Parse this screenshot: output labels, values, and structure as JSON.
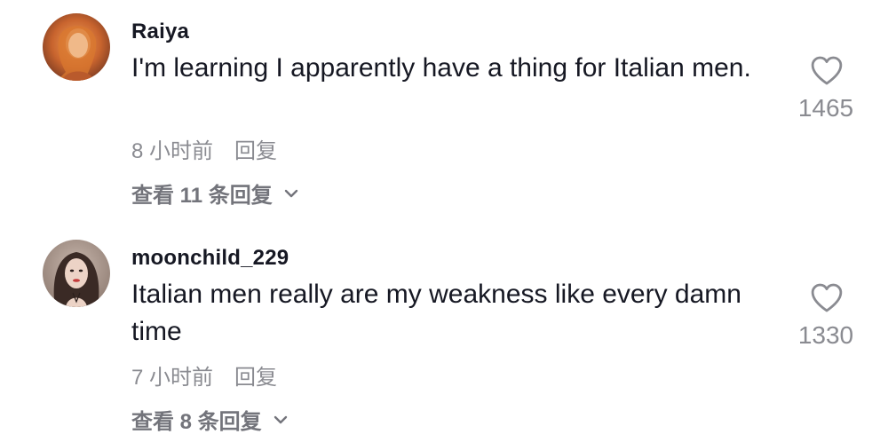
{
  "comments": [
    {
      "username": "Raiya",
      "avatar_icon": "user-avatar",
      "text": "I'm learning I apparently have a thing for Italian men.",
      "time": "8 小时前",
      "reply_label": "回复",
      "view_replies": "查看 11 条回复",
      "like_icon": "heart-outline-icon",
      "like_count": "1465"
    },
    {
      "username": "moonchild_229",
      "avatar_icon": "user-avatar",
      "text": "Italian men really are my weakness like every damn time",
      "time": "7 小时前",
      "reply_label": "回复",
      "view_replies": "查看 8 条回复",
      "like_icon": "heart-outline-icon",
      "like_count": "1330"
    }
  ],
  "colors": {
    "primary_text": "#161823",
    "secondary_text": "#8a8b91",
    "view_replies_text": "#73747b"
  }
}
